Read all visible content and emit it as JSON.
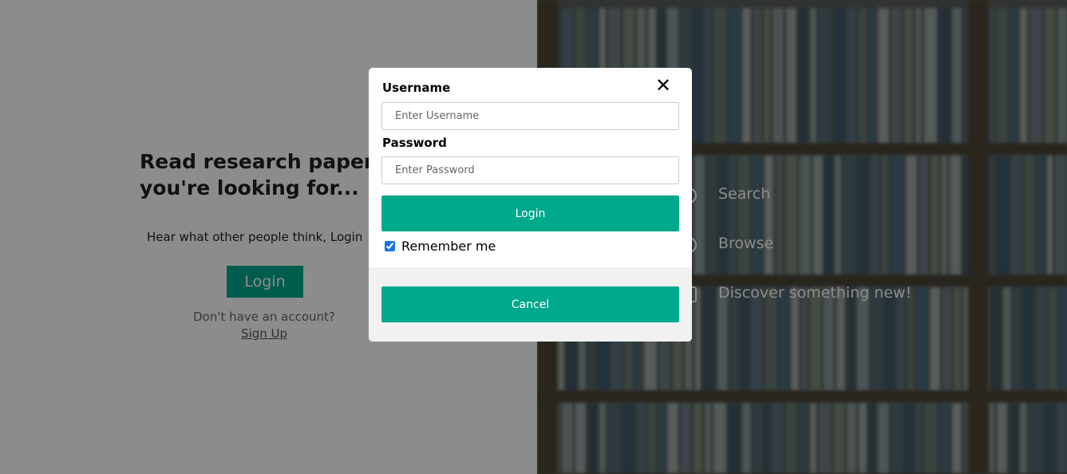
{
  "hero": {
    "title": "Read research papers you're looking for...",
    "subtitle": "Hear what other people think, Login",
    "login_label": "Login",
    "no_account_text": "Don't have an account?",
    "signup_label": "Sign Up"
  },
  "features": [
    {
      "label": "Search",
      "icon": "search-icon"
    },
    {
      "label": "Browse",
      "icon": "browse-icon"
    },
    {
      "label": "Discover something new!",
      "icon": "discover-icon"
    }
  ],
  "modal": {
    "close_icon": "close-icon",
    "username_label": "Username",
    "username_placeholder": "Enter Username",
    "password_label": "Password",
    "password_placeholder": "Enter Password",
    "login_label": "Login",
    "remember_label": "Remember me",
    "remember_checked": true,
    "cancel_label": "Cancel"
  },
  "colors": {
    "accent": "#00a88c",
    "left_bg": "#ffffff",
    "overlay": "rgba(0,0,0,0.45)"
  }
}
